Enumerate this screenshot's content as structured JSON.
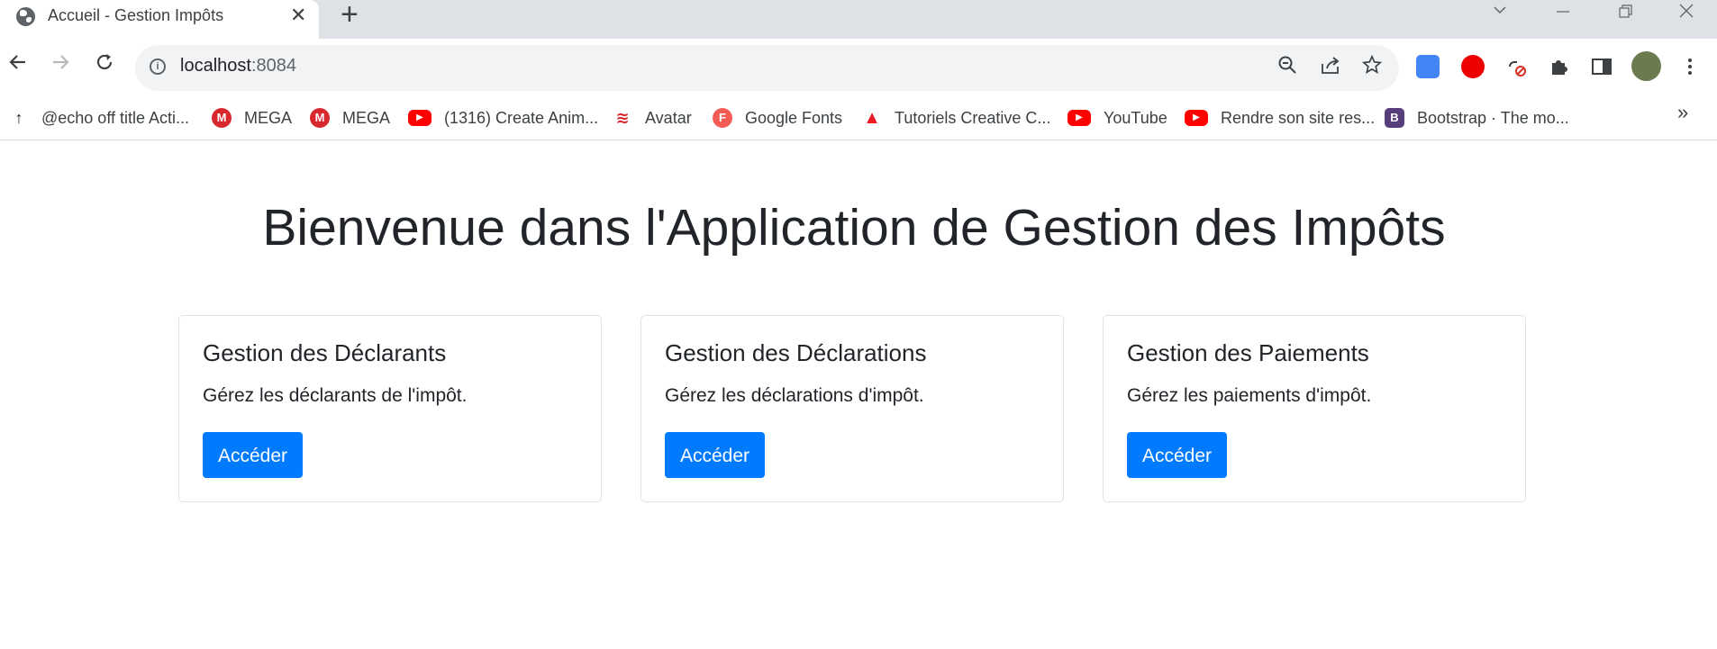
{
  "browser": {
    "tab_title": "Accueil - Gestion Impôts",
    "url_host": "localhost",
    "url_port": ":8084",
    "bookmarks": [
      {
        "label": "@echo off title Acti...",
        "icon": "arrow-up-icon"
      },
      {
        "label": "MEGA",
        "icon": "mega-icon"
      },
      {
        "label": "MEGA",
        "icon": "mega-icon"
      },
      {
        "label": "(1316) Create Anim...",
        "icon": "youtube-icon"
      },
      {
        "label": "Avatar",
        "icon": "avatar-icon"
      },
      {
        "label": "Google Fonts",
        "icon": "google-fonts-icon"
      },
      {
        "label": "Tutoriels Creative C...",
        "icon": "adobe-icon"
      },
      {
        "label": "YouTube",
        "icon": "youtube-icon"
      },
      {
        "label": "Rendre son site res...",
        "icon": "youtube-icon"
      },
      {
        "label": "Bootstrap · The mo...",
        "icon": "bootstrap-icon"
      }
    ],
    "more_label": "»"
  },
  "main": {
    "title": "Bienvenue dans l'Application de Gestion des Impôts",
    "cards": [
      {
        "title": "Gestion des Déclarants",
        "text": "Gérez les déclarants de l'impôt.",
        "button": "Accéder"
      },
      {
        "title": "Gestion des Déclarations",
        "text": "Gérez les déclarations d'impôt.",
        "button": "Accéder"
      },
      {
        "title": "Gestion des Paiements",
        "text": "Gérez les paiements d'impôt.",
        "button": "Accéder"
      }
    ]
  },
  "colors": {
    "primary": "#007bff",
    "text": "#212529",
    "youtube": "#ff0000",
    "mega": "#d9272e",
    "bootstrap": "#563d7c"
  }
}
